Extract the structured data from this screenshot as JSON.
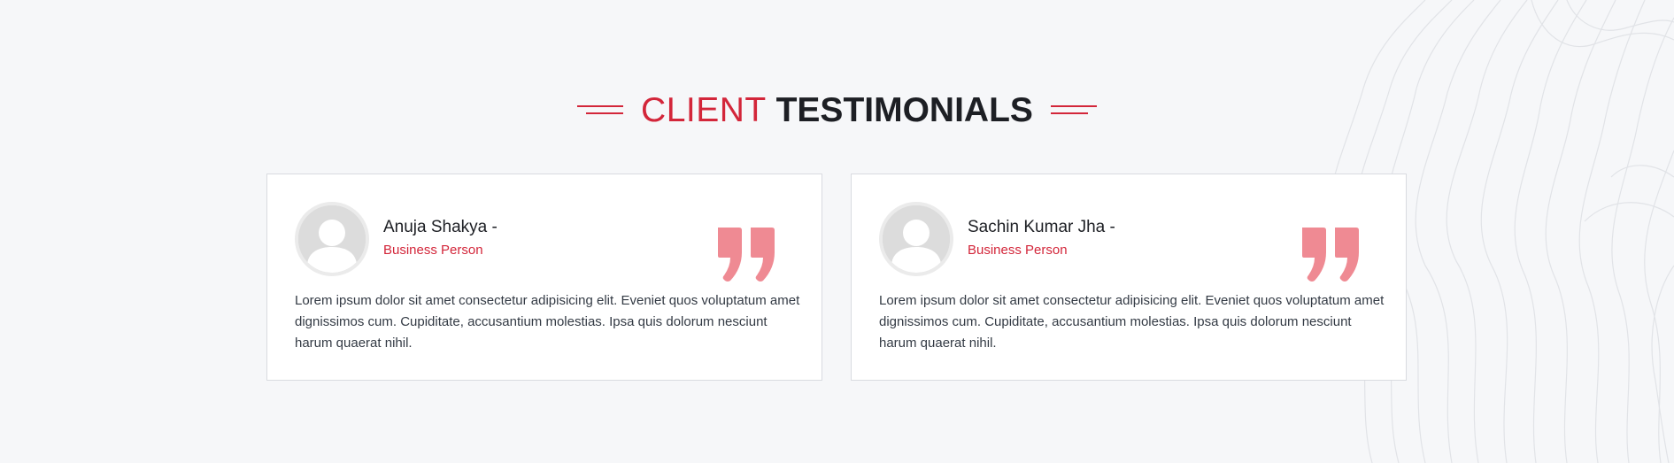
{
  "heading": {
    "light": "CLIENT",
    "bold": "TESTIMONIALS"
  },
  "colors": {
    "accent": "#d3263a",
    "quote": "#ef8a93",
    "heading_dark": "#1d1f24",
    "background": "#f6f7f9"
  },
  "testimonials": [
    {
      "name": "Anuja Shakya -",
      "role": "Business Person",
      "text": "Lorem ipsum dolor sit amet consectetur adipisicing elit. Eveniet quos voluptatum amet dignissimos cum. Cupiditate, accusantium molestias. Ipsa quis dolorum nesciunt harum quaerat nihil.",
      "avatar_icon": "user-placeholder-icon",
      "quote_icon": "quote-icon"
    },
    {
      "name": "Sachin Kumar Jha -",
      "role": "Business Person",
      "text": "Lorem ipsum dolor sit amet consectetur adipisicing elit. Eveniet quos voluptatum amet dignissimos cum. Cupiditate, accusantium molestias. Ipsa quis dolorum nesciunt harum quaerat nihil.",
      "avatar_icon": "user-placeholder-icon",
      "quote_icon": "quote-icon"
    }
  ]
}
